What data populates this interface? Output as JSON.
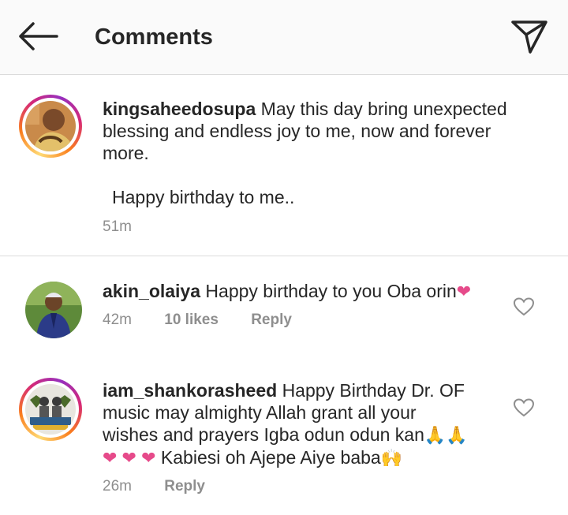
{
  "header": {
    "title": "Comments"
  },
  "caption": {
    "username": "kingsaheedosupa",
    "line1": "May this day bring unexpected",
    "line2": "blessing and endless joy to me, now and forever",
    "line3": "more.",
    "line4": "Happy birthday to me..",
    "time": "51m"
  },
  "comments": [
    {
      "username": "akin_olaiya",
      "text": "Happy birthday to you Oba orin",
      "emoji": "❤",
      "time": "42m",
      "likes": "10 likes",
      "reply": "Reply"
    },
    {
      "username": "iam_shankorasheed",
      "line1": "Happy Birthday Dr. OF",
      "line2": "music may almighty Allah grant all your",
      "line3": "wishes and prayers Igba odun odun kan",
      "line3_emoji": "🙏🙏",
      "line4_emoji": "❤ ❤ ❤",
      "line4": "Kabiesi oh Ajepe Aiye baba",
      "line4_end_emoji": "🙌",
      "time": "26m",
      "reply": "Reply"
    }
  ],
  "colors": {
    "accent_heart": "#e64a8a",
    "meta": "#8e8e8e",
    "text": "#262626"
  }
}
